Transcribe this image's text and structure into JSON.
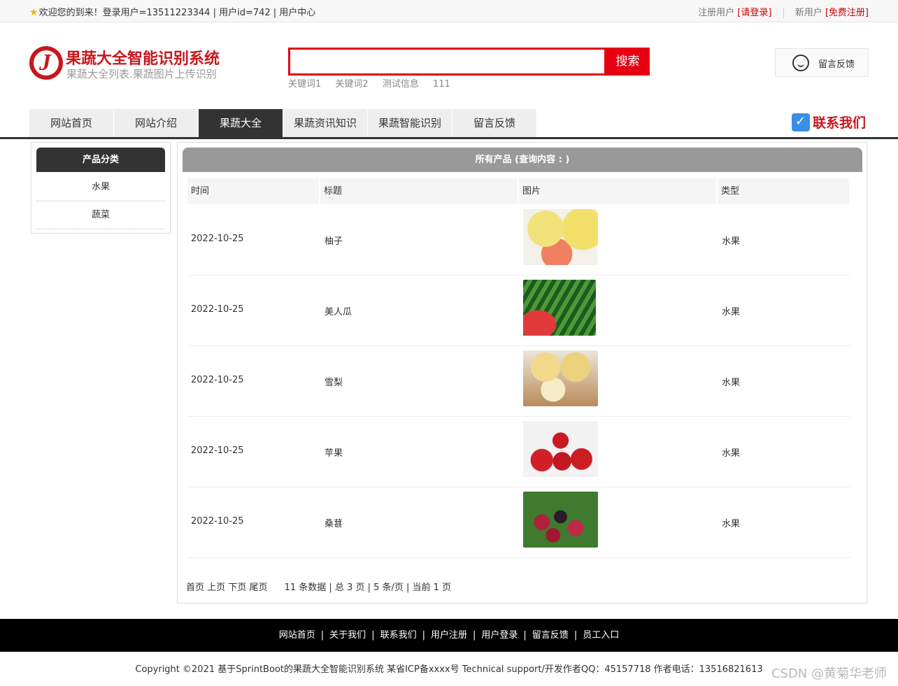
{
  "topbar": {
    "welcome": "欢迎您的到来！登录用户=13511223344 | 用户id=742 | 用户中心",
    "login_prefix": "注册用户 ",
    "login_link": "[请登录]",
    "register_prefix": "新用户 ",
    "register_link": "[免费注册]"
  },
  "header": {
    "title": "果蔬大全智能识别系统",
    "subtitle": "果蔬大全列表.果蔬图片上传识别",
    "search_button": "搜索",
    "keywords": [
      "关键词1",
      "关键词2",
      "测试信息",
      "111"
    ],
    "feedback": "留言反馈"
  },
  "nav": {
    "items": [
      "网站首页",
      "网站介绍",
      "果蔬大全",
      "果蔬资讯知识",
      "果蔬智能识别",
      "留言反馈"
    ],
    "active_index": 2,
    "contact": "联系我们"
  },
  "sidebar": {
    "title": "产品分类",
    "categories": [
      "水果",
      "蔬菜"
    ]
  },
  "main": {
    "title": "所有产品 (查询内容 : )",
    "columns": [
      "时间",
      "标题",
      "图片",
      "类型"
    ],
    "rows": [
      {
        "date": "2022-10-25",
        "title": "柚子",
        "image": "pomelo-image",
        "type": "水果"
      },
      {
        "date": "2022-10-25",
        "title": "美人瓜",
        "image": "watermelon-image",
        "type": "水果"
      },
      {
        "date": "2022-10-25",
        "title": "雪梨",
        "image": "pear-image",
        "type": "水果"
      },
      {
        "date": "2022-10-25",
        "title": "苹果",
        "image": "apple-image",
        "type": "水果"
      },
      {
        "date": "2022-10-25",
        "title": "桑葚",
        "image": "mulberry-image",
        "type": "水果"
      }
    ],
    "pager": {
      "first": "首页",
      "prev": "上页",
      "next": "下页",
      "last": "尾页",
      "info": "11 条数据 | 总 3 页 | 5 条/页 | 当前 1 页"
    }
  },
  "footer": {
    "links": [
      "网站首页",
      "关于我们",
      "联系我们",
      "用户注册",
      "用户登录",
      "留言反馈",
      "员工入口"
    ],
    "copyright": "Copyright ©2021 基于SprintBoot的果蔬大全智能识别系统    某省ICP备xxxx号    Technical support/开发作者QQ：45157718    作者电话：13516821613",
    "watermark": "CSDN @黄菊华老师"
  },
  "colors": {
    "brand_red": "#c8161d",
    "search_red": "#e60012",
    "nav_active": "#333333"
  }
}
